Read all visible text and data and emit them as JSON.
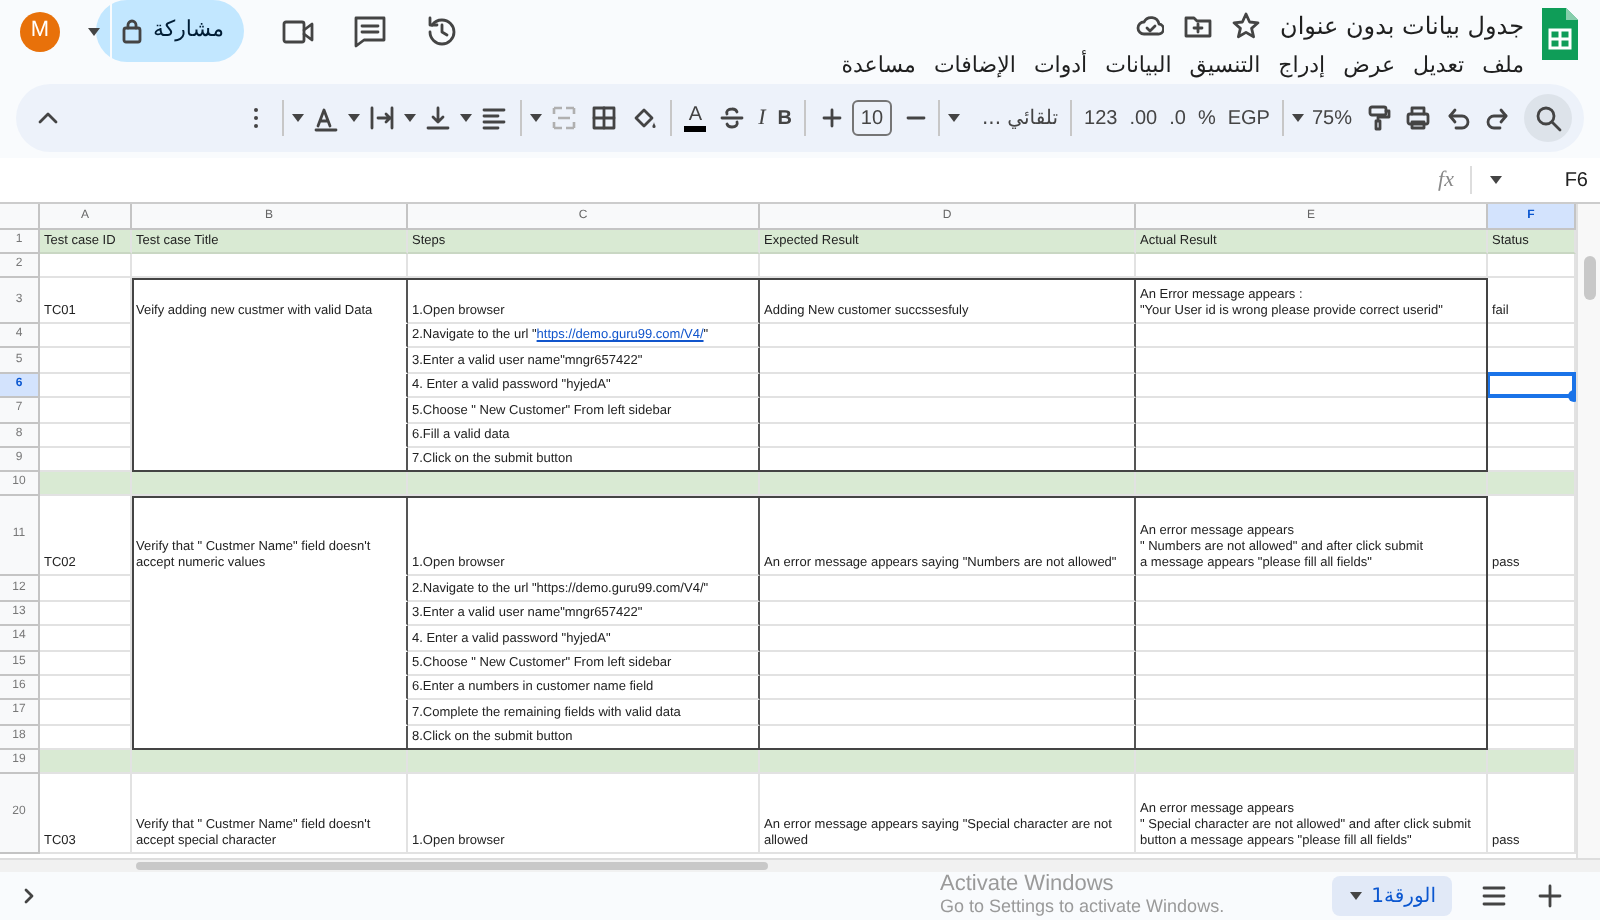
{
  "app": {
    "title": "جدول بيانات بدون عنوان",
    "menu": [
      "ملف",
      "تعديل",
      "عرض",
      "إدراج",
      "التنسيق",
      "البيانات",
      "أدوات",
      "الإضافات",
      "مساعدة"
    ],
    "share_label": "مشاركة",
    "avatar_initial": "M"
  },
  "toolbar": {
    "zoom": "75%",
    "currency": "EGP",
    "percent": "%",
    "decrease_decimal": ".0",
    "increase_decimal": ".00",
    "number_format": "123",
    "font": "تلقائي ...",
    "font_size": "10",
    "bold": "B",
    "italic": "I",
    "text_color": "A"
  },
  "formula_bar": {
    "cell_ref": "F6",
    "fx": "fx"
  },
  "sheet": {
    "columns": [
      {
        "letter": "A",
        "selected": false
      },
      {
        "letter": "B",
        "selected": false
      },
      {
        "letter": "C",
        "selected": false
      },
      {
        "letter": "D",
        "selected": false
      },
      {
        "letter": "E",
        "selected": false
      },
      {
        "letter": "F",
        "selected": true
      }
    ],
    "rows": [
      {
        "kind": "header",
        "row": "1",
        "selected": false,
        "cells": [
          "Test case ID",
          "Test case Title",
          "Steps",
          "Expected Result",
          "Actual Result",
          "Status"
        ]
      },
      {
        "kind": "blank",
        "row": "2",
        "selected": false
      },
      {
        "kind": "case",
        "outlined": true,
        "id": "TC01",
        "title": "Veify adding  new custmer with valid Data",
        "expected": "Adding New customer succssesfuly",
        "actual": "An Error message appears :\n\"Your User id is wrong please provide correct userid\"",
        "status": "fail",
        "steps": [
          {
            "row": "3",
            "selected": false,
            "kind": "text",
            "text": "1.Open browser"
          },
          {
            "row": "4",
            "selected": false,
            "kind": "link",
            "before": "2.Navigate to the url \"",
            "link": "https://demo.guru99.com/V4/",
            "after": "\""
          },
          {
            "row": "5",
            "selected": false,
            "kind": "text",
            "text": "3.Enter a valid user name\"mngr657422\""
          },
          {
            "row": "6",
            "selected": true,
            "kind": "text",
            "text": "4. Enter a valid password \"hyjedA\""
          },
          {
            "row": "7",
            "selected": false,
            "kind": "text",
            "text": "5.Choose \" New Customer\" From left sidebar"
          },
          {
            "row": "8",
            "selected": false,
            "kind": "text",
            "text": "6.Fill a valid data"
          },
          {
            "row": "9",
            "selected": false,
            "kind": "text",
            "text": "7.Click on  the submit button"
          }
        ]
      },
      {
        "kind": "band",
        "row": "10",
        "selected": false
      },
      {
        "kind": "case",
        "outlined": true,
        "id": "TC02",
        "title": "Verify that \" Custmer Name\" field doesn't accept numeric values",
        "expected": "An error message appears saying  \"Numbers are  not allowed\"",
        "actual": "An error message appears\n \" Numbers are not allowed\" and after click submit\n a message appears \"please fill all fields\"",
        "status": "pass",
        "steps": [
          {
            "row": "11",
            "selected": false,
            "kind": "text",
            "text": "1.Open browser"
          },
          {
            "row": "12",
            "selected": false,
            "kind": "text",
            "text": "2.Navigate to the url \"https://demo.guru99.com/V4/\""
          },
          {
            "row": "13",
            "selected": false,
            "kind": "text",
            "text": "3.Enter a valid user name\"mngr657422\""
          },
          {
            "row": "14",
            "selected": false,
            "kind": "text",
            "text": "4. Enter a valid password \"hyjedA\""
          },
          {
            "row": "15",
            "selected": false,
            "kind": "text",
            "text": "5.Choose \" New Customer\" From left sidebar"
          },
          {
            "row": "16",
            "selected": false,
            "kind": "text",
            "text": "6.Enter a numbers in customer name field"
          },
          {
            "row": "17",
            "selected": false,
            "kind": "text",
            "text": "7.Complete the remaining fields with valid data"
          },
          {
            "row": "18",
            "selected": false,
            "kind": "text",
            "text": "8.Click on the submit button"
          }
        ]
      },
      {
        "kind": "band",
        "row": "19",
        "selected": false
      },
      {
        "kind": "case",
        "outlined": false,
        "id": "TC03",
        "title": "Verify that \" Custmer Name\" field doesn't accept special character",
        "expected": "An error message appears saying \"Special character are not allowed",
        "actual": "An error message appears\n\" Special character are not allowed\"  and after click submit\nbutton a message appears \"please fill all fields\"",
        "status": "pass",
        "steps": [
          {
            "row": "20",
            "selected": false,
            "kind": "text",
            "text": "1.Open browser"
          }
        ]
      }
    ]
  },
  "sheet_tab": {
    "label": "الورقة1"
  },
  "activation_notice": {
    "title": "Activate Windows",
    "detail": "Go to Settings to activate Windows."
  }
}
